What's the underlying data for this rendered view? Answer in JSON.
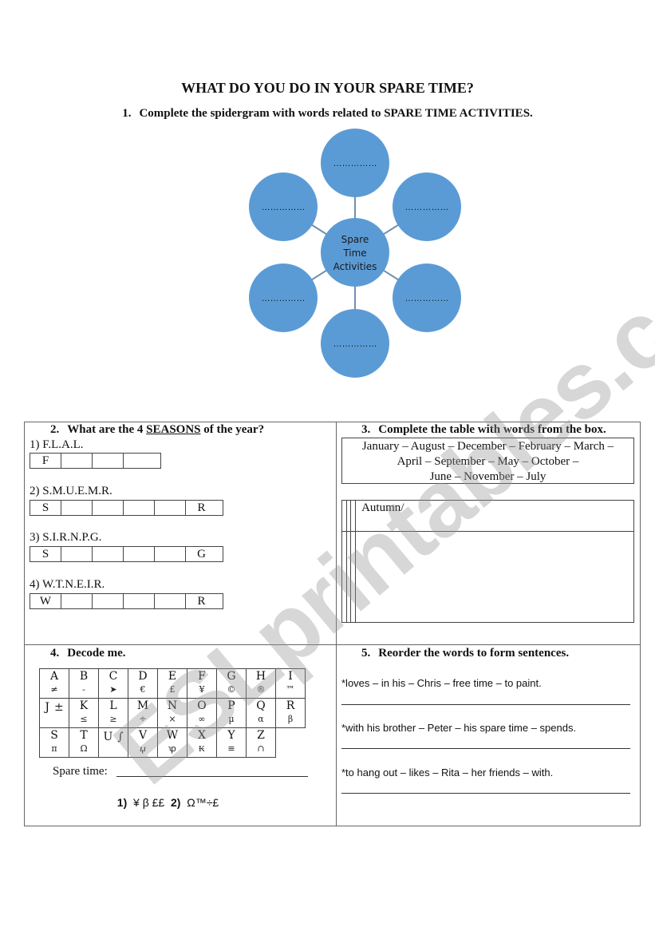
{
  "title": "WHAT DO YOU DO IN YOUR SPARE TIME?",
  "exercise1": {
    "number": "1.",
    "instruction": "Complete the spidergram with words related to SPARE TIME ACTIVITIES.",
    "center_label": [
      "Spare",
      "Time",
      "Activities"
    ],
    "bubbles": [
      "……………",
      "……………",
      "……………",
      "……………",
      "……………",
      "……………"
    ],
    "colors": {
      "bubble_fill": "#5b9bd5",
      "connector": "#6f8fb0"
    }
  },
  "exercise2": {
    "number": "2.",
    "heading_pre": "What are the 4 ",
    "heading_underlined": "SEASONS",
    "heading_post": " of the year?",
    "items": [
      {
        "label": "1) F.L.A.L.",
        "cells": [
          "F",
          "",
          "",
          ""
        ]
      },
      {
        "label": "2) S.M.U.E.M.R.",
        "cells": [
          "S",
          "",
          "",
          "",
          "",
          "R"
        ]
      },
      {
        "label": "3) S.I.R.N.P.G.",
        "cells": [
          "S",
          "",
          "",
          "",
          "",
          "G"
        ]
      },
      {
        "label": "4) W.T.N.E.I.R.",
        "cells": [
          "W",
          "",
          "",
          "",
          "",
          "R"
        ]
      }
    ]
  },
  "exercise3": {
    "number": "3.",
    "heading": "Complete the table with words from the box.",
    "word_box_lines": [
      "January – August – December – February – March –",
      "April – September – May – October –",
      "June – November – July"
    ],
    "table_headers": [
      "",
      "",
      "",
      "Autumn/"
    ]
  },
  "exercise4": {
    "number": "4.",
    "heading": "Decode me.",
    "code_rows": [
      [
        {
          "letter": "A",
          "symbol": "≠"
        },
        {
          "letter": "B",
          "symbol": "-"
        },
        {
          "letter": "C",
          "symbol": "➤"
        },
        {
          "letter": "D",
          "symbol": "€"
        },
        {
          "letter": "E",
          "symbol": "£"
        },
        {
          "letter": "F",
          "symbol": "¥"
        },
        {
          "letter": "G",
          "symbol": "©"
        },
        {
          "letter": "H",
          "symbol": "®"
        },
        {
          "letter": "I",
          "symbol": "™"
        }
      ],
      [
        {
          "letter": "J",
          "symbol": "±",
          "inline": true
        },
        {
          "letter": "K",
          "symbol": "≤"
        },
        {
          "letter": "L",
          "symbol": "≥"
        },
        {
          "letter": "M",
          "symbol": "÷"
        },
        {
          "letter": "N",
          "symbol": "×"
        },
        {
          "letter": "O",
          "symbol": "∞"
        },
        {
          "letter": "P",
          "symbol": "µ"
        },
        {
          "letter": "Q",
          "symbol": "α"
        },
        {
          "letter": "R",
          "symbol": "β"
        }
      ],
      [
        {
          "letter": "S",
          "symbol": "π"
        },
        {
          "letter": "T",
          "symbol": "Ω"
        },
        {
          "letter": "U",
          "symbol": "∫",
          "inline": true
        },
        {
          "letter": "V",
          "symbol": "ⴤ"
        },
        {
          "letter": "W",
          "symbol": "ꝕ"
        },
        {
          "letter": "X",
          "symbol": "₭"
        },
        {
          "letter": "Y",
          "symbol": "≡"
        },
        {
          "letter": "Z",
          "symbol": "∩"
        }
      ]
    ],
    "spare_time_label": "Spare time:",
    "code_label_1": "1)",
    "code_1": "¥ β ££",
    "code_label_2": "2)",
    "code_2": "Ω™÷£"
  },
  "exercise5": {
    "number": "5.",
    "heading": "Reorder the words to form sentences.",
    "sentences": [
      "*loves – in his – Chris – free time – to paint.",
      "*with his brother – Peter – his spare time – spends.",
      "*to hang out – likes – Rita – her friends – with."
    ]
  },
  "watermark": "ESLprintables.com"
}
